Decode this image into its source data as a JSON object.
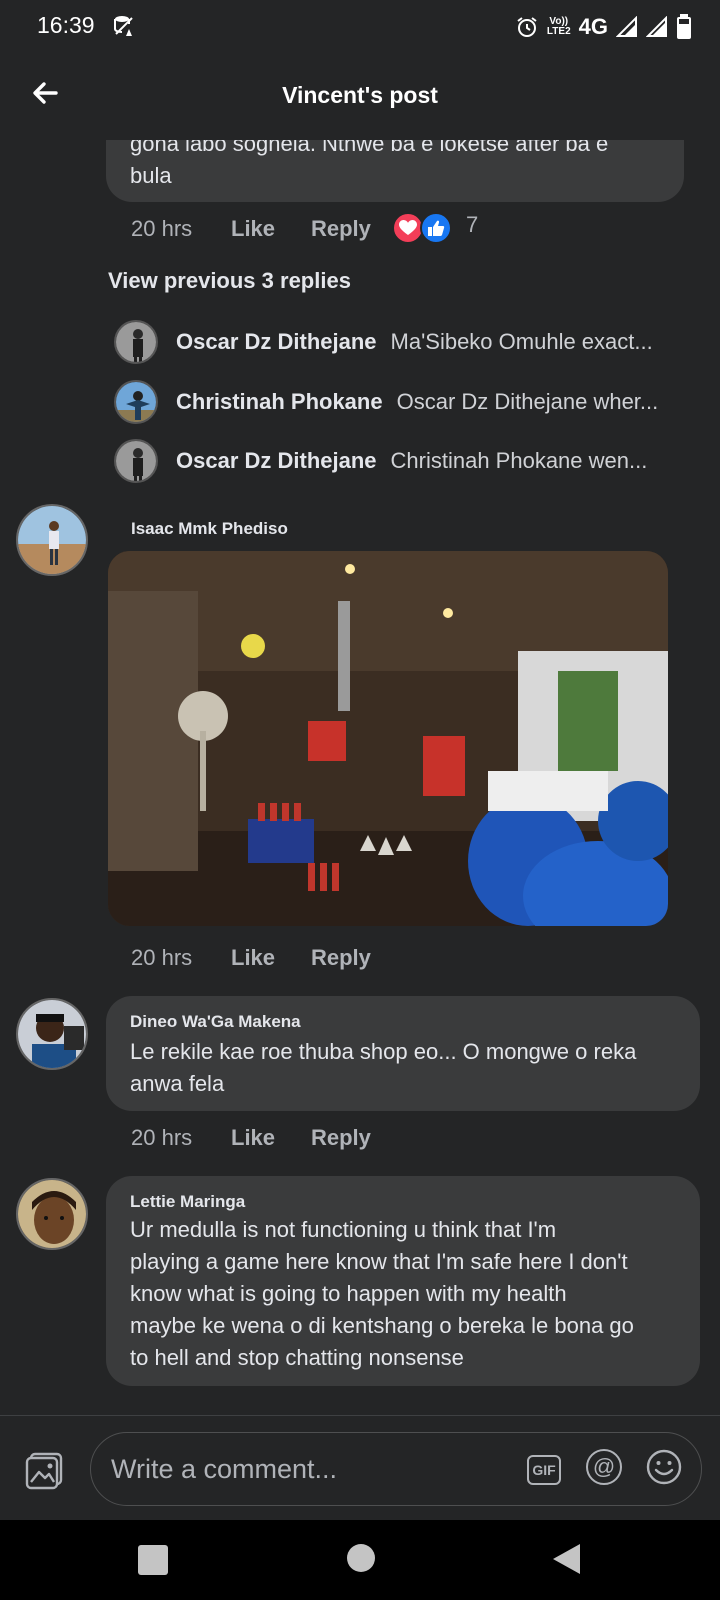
{
  "status_bar": {
    "time": "16:39",
    "network": "4G",
    "volte_line1": "Vo))",
    "volte_line2": "LTE2",
    "icons": [
      "data-saver-icon",
      "alarm-icon",
      "signal-icon",
      "signal-icon",
      "battery-icon"
    ]
  },
  "header": {
    "title": "Vincent's post",
    "back_icon": "back-arrow-icon"
  },
  "comments": {
    "first": {
      "text_line1": "gona labo sognela. Nthwe ba e loketse after ba e",
      "text_line2": "bula",
      "time": "20 hrs",
      "like": "Like",
      "reply": "Reply",
      "reaction_count": "7",
      "reaction_icons": [
        "love-reaction-icon",
        "like-reaction-icon"
      ]
    },
    "view_previous": "View previous 3 replies",
    "replies": [
      {
        "name": "Oscar Dz Dithejane",
        "snippet": "Ma'Sibeko Omuhle exact..."
      },
      {
        "name": "Christinah Phokane",
        "snippet": "Oscar Dz Dithejane wher..."
      },
      {
        "name": "Oscar Dz Dithejane",
        "snippet": "Christinah Phokane wen..."
      }
    ],
    "photo_comment": {
      "name": "Isaac Mmk Phediso",
      "time": "20 hrs",
      "like": "Like",
      "reply": "Reply"
    },
    "dineo": {
      "name": "Dineo Wa'Ga Makena",
      "text_line1": "Le rekile kae roe thuba shop eo... O mongwe o reka",
      "text_line2": "anwa fela",
      "time": "20 hrs",
      "like": "Like",
      "reply": "Reply"
    },
    "lettie": {
      "name": "Lettie Maringa",
      "lines": [
        "Ur medulla is not functioning u think that I'm",
        "playing a game here know that I'm safe here I don't",
        "know what is going to happen with my health",
        "maybe ke wena o di kentshang o bereka le bona go",
        "to hell and stop chatting nonsense"
      ]
    }
  },
  "composer": {
    "placeholder": "Write a comment...",
    "gif_label": "GIF",
    "mention_label": "@",
    "icons": [
      "photo-icon",
      "gif-icon",
      "mention-icon",
      "emoji-icon"
    ]
  },
  "navbar": {
    "icons": [
      "recents-icon",
      "home-icon",
      "back-icon"
    ]
  }
}
